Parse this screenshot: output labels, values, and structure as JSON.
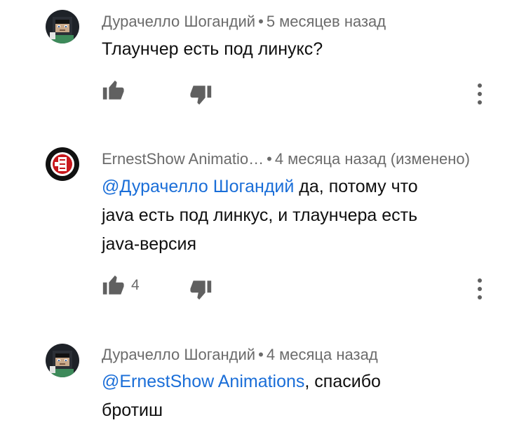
{
  "comments": [
    {
      "author": "Дурачелло Шогандий",
      "time": "5 месяцев назад",
      "avatar": "pixel-character-avatar",
      "mention": "",
      "text_line1": "Тлаунчер есть под линукс?",
      "text_line2": "",
      "text_line3": "",
      "likes": ""
    },
    {
      "author": "ErnestShow Animatio…",
      "time": "4 месяца назад (изменено)",
      "avatar": "ernestshow-logo-avatar",
      "mention": "@Дурачелло Шогандий",
      "text_line1": " да, потому что",
      "text_line2": "java есть под линкус, и тлаунчера есть",
      "text_line3": "java-версия",
      "likes": "4"
    },
    {
      "author": "Дурачелло Шогандий",
      "time": "4 месяца назад",
      "avatar": "pixel-character-avatar",
      "mention": "@ErnestShow Animations",
      "text_line1": ", спасибо",
      "text_line2": "бротиш",
      "text_line3": "",
      "likes": ""
    }
  ],
  "icons": {
    "like": "thumbs-up-icon",
    "dislike": "thumbs-down-icon",
    "menu": "more-vertical-icon"
  },
  "colors": {
    "mention": "#1a6ed8",
    "meta": "#6b6b6b",
    "icon": "#606060"
  }
}
